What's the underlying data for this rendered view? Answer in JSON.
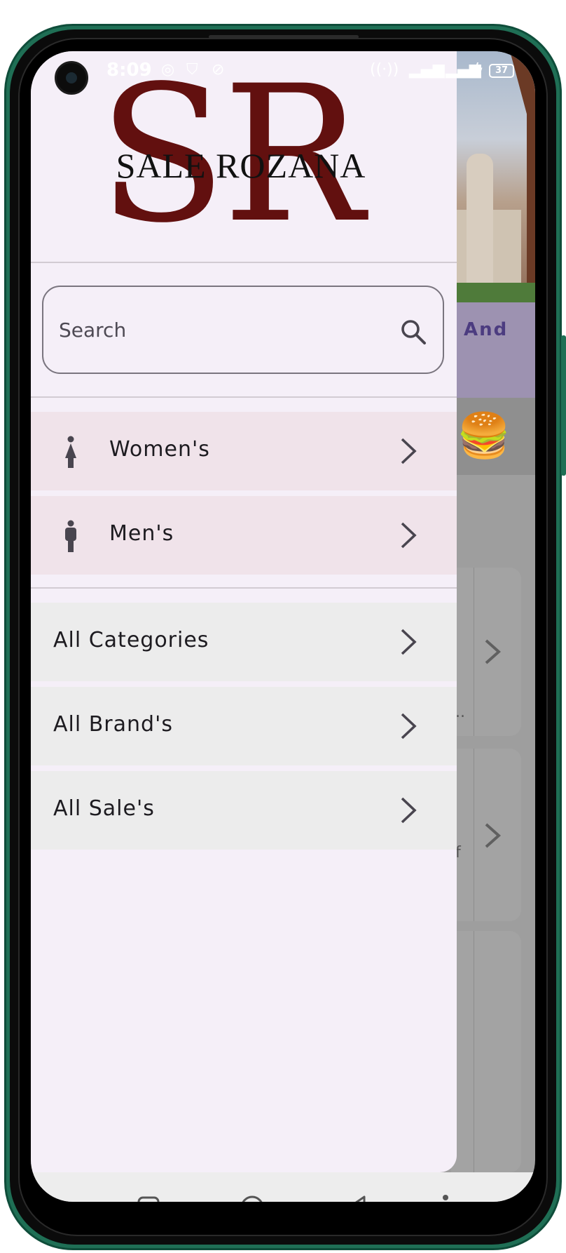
{
  "status_bar": {
    "time": "8:09",
    "battery": "37"
  },
  "brand": {
    "letters": "SR",
    "name": "SALE ROZANA",
    "color": "#62100f"
  },
  "search": {
    "placeholder": "Search",
    "value": ""
  },
  "gender_menu": [
    {
      "label": "Women's",
      "icon": "woman-icon"
    },
    {
      "label": "Men's",
      "icon": "man-icon"
    }
  ],
  "category_menu": [
    {
      "label": "All Categories"
    },
    {
      "label": "All Brand's"
    },
    {
      "label": "All Sale's"
    }
  ],
  "background_app": {
    "band_text": "And",
    "card_snippet_1": "..",
    "card_snippet_2": "f"
  },
  "nav_bar": {
    "buttons": [
      "recents-button",
      "home-button",
      "back-button",
      "accessibility-button"
    ]
  },
  "colors": {
    "drawer_bg": "#f5eff8",
    "gender_row_bg": "#f0e3ea",
    "category_row_bg": "#ececec",
    "phone_frame": "#1f6f55"
  }
}
